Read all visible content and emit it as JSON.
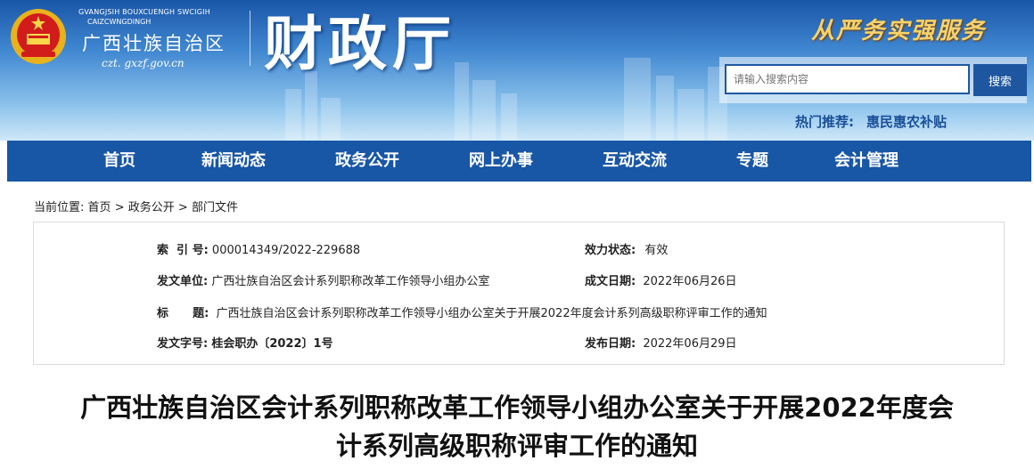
{
  "header": {
    "pinyin_line1": "GVANGJSIH BOUXCUENGH SWCIGIH",
    "pinyin_line2": "CAIZCWNGDINGH",
    "region_name": "广西壮族自治区",
    "domain": "czt. gxzf.gov.cn",
    "department": "财政厅",
    "slogan": "从严务实强服务",
    "emblem_icon": "national-emblem-icon"
  },
  "search": {
    "placeholder": "请输入搜索内容",
    "button_label": "搜索",
    "hot_label": "热门推荐:",
    "hot_link": "惠民惠农补贴"
  },
  "nav": {
    "items": [
      "首页",
      "新闻动态",
      "政务公开",
      "网上办事",
      "互动交流",
      "专题",
      "会计管理"
    ]
  },
  "breadcrumb": {
    "prefix": "当前位置:",
    "items": [
      "首页",
      "政务公开",
      "部门文件"
    ],
    "separator": ">"
  },
  "info": {
    "index_label": "索  引 号:",
    "index_value": "000014349/2022-229688",
    "status_label": "效力状态:",
    "status_value": "有效",
    "issuer_label": "发文单位:",
    "issuer_value": "广西壮族自治区会计系列职称改革工作领导小组办公室",
    "created_label": "成文日期:",
    "created_value": "2022年06月26日",
    "subject_label": "标      题:",
    "subject_value": "广西壮族自治区会计系列职称改革工作领导小组办公室关于开展2022年度会计系列高级职称评审工作的通知",
    "docno_label": "发文字号:",
    "docno_value": "桂会职办〔2022〕1号",
    "published_label": "发布日期:",
    "published_value": "2022年06月29日"
  },
  "article": {
    "title_line1": "广西壮族自治区会计系列职称改革工作领导小组办公室关于开展2022年度会",
    "title_line2": "计系列高级职称评审工作的通知"
  },
  "colors": {
    "nav_bg": "#1856a6",
    "header_top": "#1a56a8",
    "slogan": "#f7d36a",
    "hot_text": "#1a4f99"
  }
}
